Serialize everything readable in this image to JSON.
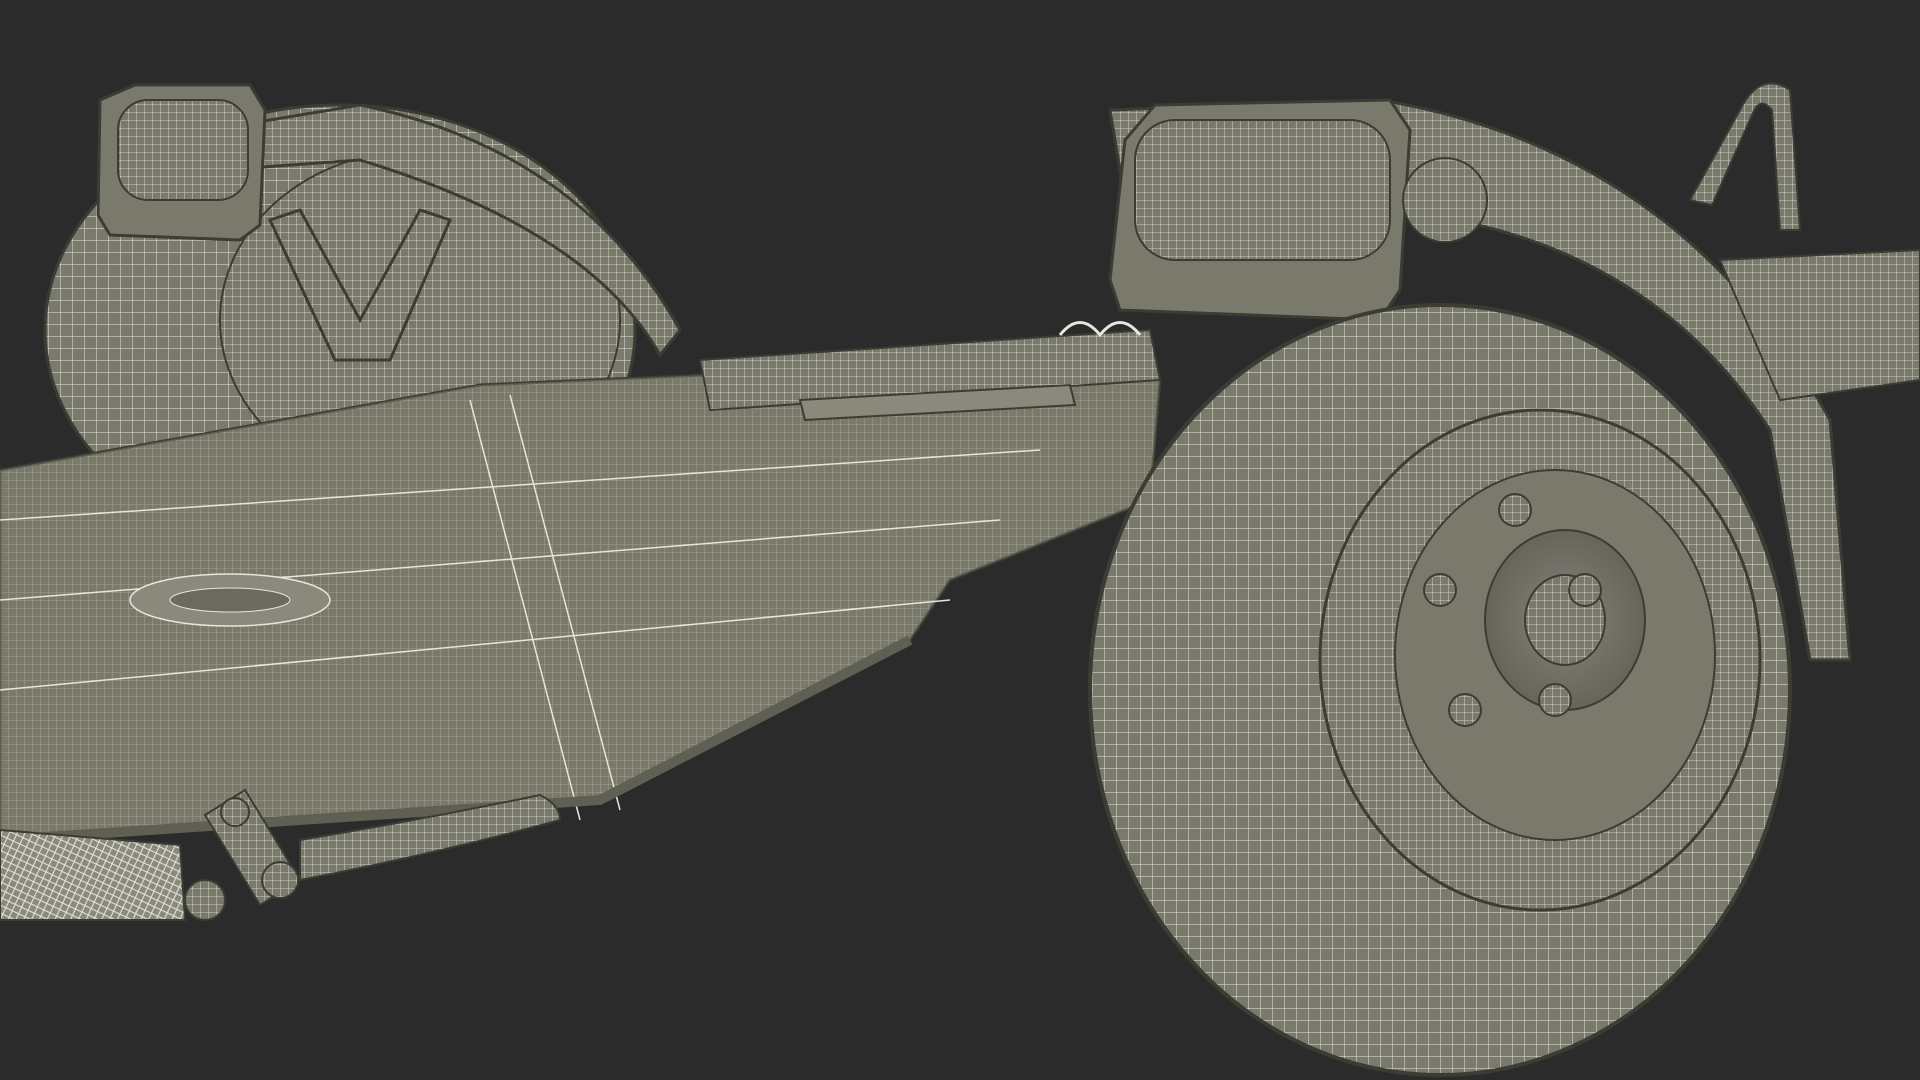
{
  "scene": {
    "background_color": "#2b2b2b",
    "surface_color": "#7a7a6c",
    "surface_shadow_color": "#5f5f54",
    "wire_color": "#e6e6dc",
    "edge_color": "#3c3c34"
  }
}
